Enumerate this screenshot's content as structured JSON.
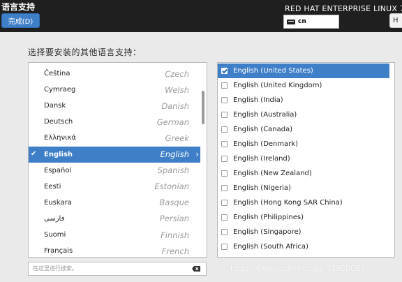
{
  "header": {
    "title": "语言支持",
    "done_label": "完成(D)",
    "product": "RED HAT ENTERPRISE LINUX 7.",
    "keyboard_layout": "cn",
    "help_label": "H"
  },
  "prompt": "选择要安装的其他语言支持：",
  "languages": [
    {
      "native": "Čeština",
      "english": "Czech"
    },
    {
      "native": "Cymraeg",
      "english": "Welsh"
    },
    {
      "native": "Dansk",
      "english": "Danish"
    },
    {
      "native": "Deutsch",
      "english": "German"
    },
    {
      "native": "Ελληνικά",
      "english": "Greek"
    },
    {
      "native": "English",
      "english": "English",
      "selected": true,
      "checked": true
    },
    {
      "native": "Español",
      "english": "Spanish"
    },
    {
      "native": "Eesti",
      "english": "Estonian"
    },
    {
      "native": "Euskara",
      "english": "Basque"
    },
    {
      "native": "فارسی",
      "english": "Persian"
    },
    {
      "native": "Suomi",
      "english": "Finnish"
    },
    {
      "native": "Français",
      "english": "French"
    }
  ],
  "search": {
    "placeholder": "在这里进行搜索。"
  },
  "locales": [
    {
      "label": "English (United States)",
      "checked": true,
      "selected": true
    },
    {
      "label": "English (United Kingdom)",
      "checked": false
    },
    {
      "label": "English (India)",
      "checked": false
    },
    {
      "label": "English (Australia)",
      "checked": false
    },
    {
      "label": "English (Canada)",
      "checked": false
    },
    {
      "label": "English (Denmark)",
      "checked": false
    },
    {
      "label": "English (Ireland)",
      "checked": false
    },
    {
      "label": "English (New Zealand)",
      "checked": false
    },
    {
      "label": "English (Nigeria)",
      "checked": false
    },
    {
      "label": "English (Hong Kong SAR China)",
      "checked": false
    },
    {
      "label": "English (Philippines)",
      "checked": false
    },
    {
      "label": "English (Singapore)",
      "checked": false
    },
    {
      "label": "English (South Africa)",
      "checked": false
    }
  ],
  "watermark": "https://blog.csdn.net/qq_43928088",
  "colors": {
    "accent": "#3f7fc8",
    "header_bg": "#1f1f1f",
    "page_bg": "#eaeaea"
  }
}
